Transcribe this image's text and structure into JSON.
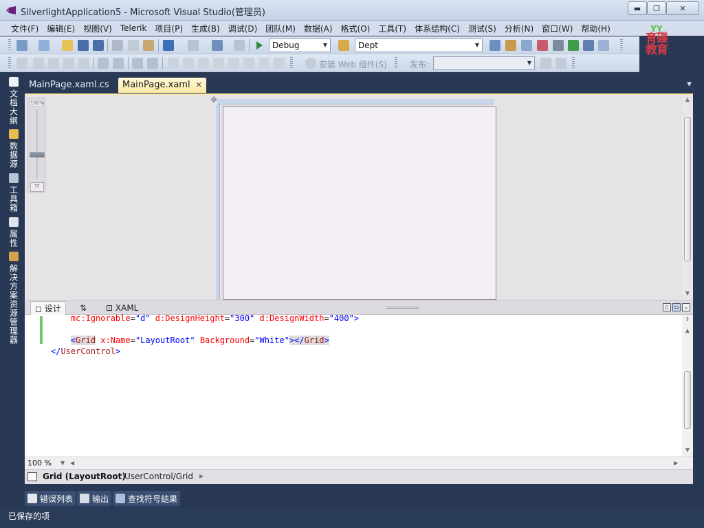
{
  "window": {
    "title": "SilverlightApplication5 - Microsoft Visual Studio(管理员)",
    "minimize_label": "▬",
    "maximize_label": "❐",
    "close_label": "✕"
  },
  "menu": [
    "文件(F)",
    "编辑(E)",
    "视图(V)",
    "Telerik",
    "项目(P)",
    "生成(B)",
    "调试(D)",
    "团队(M)",
    "数据(A)",
    "格式(O)",
    "工具(T)",
    "体系结构(C)",
    "测试(S)",
    "分析(N)",
    "窗口(W)",
    "帮助(H)"
  ],
  "toolbar": {
    "config_value": "Debug",
    "project_value": "Dept",
    "install_web_label": "安装 Web 组件(S)",
    "publish_label": "发布:",
    "publish_value": ""
  },
  "logo": {
    "top": "YY",
    "line1": "育碟",
    "line2": "教育"
  },
  "left_dock": [
    "文档大纲",
    "数据源",
    "工具箱",
    "属性",
    "解决方案资源管理器"
  ],
  "doc_tabs": [
    {
      "label": "MainPage.xaml.cs",
      "active": false
    },
    {
      "label": "MainPage.xaml",
      "active": true
    }
  ],
  "designer": {
    "zoom_slider_label": "100%",
    "panel_tabs": {
      "design": "设计",
      "swap": "⇅",
      "xaml": "XAML"
    }
  },
  "code_lines": {
    "line1": {
      "indent": "    ",
      "a1": "mc:Ignorable",
      "v1": "\"d\"",
      "a2": "d:DesignHeight",
      "v2": "\"300\"",
      "a3": "d:DesignWidth",
      "v3": "\"400\"",
      "end": ">"
    },
    "line2": {
      "indent": "    ",
      "open": "<",
      "tag": "Grid",
      "a1": "x:Name",
      "v1": "\"LayoutRoot\"",
      "a2": "Background",
      "v2": "\"White\"",
      "close": "></",
      "tag2": "Grid",
      "end": ">"
    },
    "line3": {
      "open": "</",
      "tag": "UserControl",
      "end": ">"
    }
  },
  "code_status": {
    "zoom": "100 %"
  },
  "breadcrumb": {
    "element": "Grid (LayoutRoot)",
    "path": "UserControl/Grid"
  },
  "bottom_tabs": [
    "错误列表",
    "输出",
    "查找符号结果"
  ],
  "status": "已保存的项",
  "colors": {
    "frame": "#293955",
    "active_tab": "#fbe9a6",
    "logo_red": "#d83a45",
    "logo_green": "#5bbf3a"
  }
}
